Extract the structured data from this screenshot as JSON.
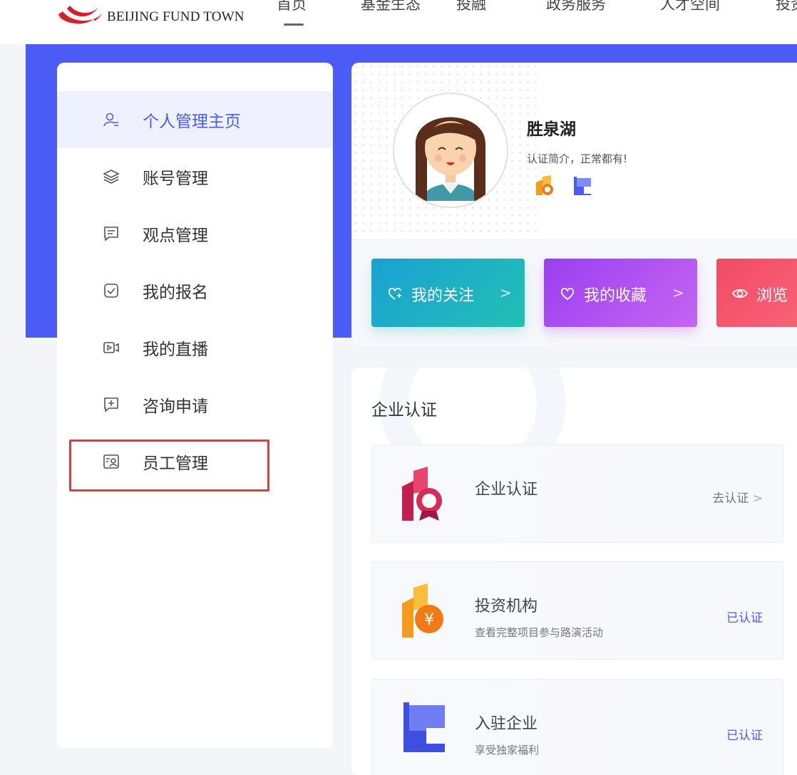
{
  "header": {
    "logo_text": "BEIJING FUND TOWN",
    "nav": [
      "首页",
      "基金生态",
      "投融",
      "政务服务",
      "人才空间",
      "投资"
    ]
  },
  "colors": {
    "brand_blue": "#4b5cf6",
    "highlight_red": "#e23b3b",
    "follow_gradient": [
      "#1aa1d4",
      "#23c0b4"
    ],
    "favorite_gradient": [
      "#9b3ff0",
      "#c565f2"
    ],
    "browse_gradient": [
      "#f24a66",
      "#fb6e7d"
    ]
  },
  "sidebar": {
    "items": [
      {
        "label": "个人管理主页",
        "icon": "user-icon",
        "active": true
      },
      {
        "label": "账号管理",
        "icon": "layers-icon"
      },
      {
        "label": "观点管理",
        "icon": "comment-icon"
      },
      {
        "label": "我的报名",
        "icon": "check-square-icon"
      },
      {
        "label": "我的直播",
        "icon": "video-icon"
      },
      {
        "label": "咨询申请",
        "icon": "plus-message-icon"
      },
      {
        "label": "员工管理",
        "icon": "staff-card-icon"
      }
    ]
  },
  "profile": {
    "name": "胜泉湖",
    "bio": "认证简介，正常都有!",
    "badges": [
      "enterprise-badge-icon",
      "flag-badge-icon"
    ]
  },
  "actions": [
    {
      "label": "我的关注",
      "icon": "heart-plus-icon",
      "arrow": ">"
    },
    {
      "label": "我的收藏",
      "icon": "heart-icon",
      "arrow": ">"
    },
    {
      "label": "浏览",
      "icon": "eye-icon"
    }
  ],
  "certification": {
    "title": "企业认证",
    "cards": [
      {
        "title": "企业认证",
        "subtitle": "",
        "status": "去认证",
        "status_arrow": ">",
        "icon": "enterprise-cert-icon"
      },
      {
        "title": "投资机构",
        "subtitle": "查看完整项目参与路演活动",
        "status": "已认证",
        "icon": "investment-yen-icon"
      },
      {
        "title": "入驻企业",
        "subtitle": "享受独家福利",
        "status": "已认证",
        "icon": "flag-icon"
      }
    ]
  }
}
